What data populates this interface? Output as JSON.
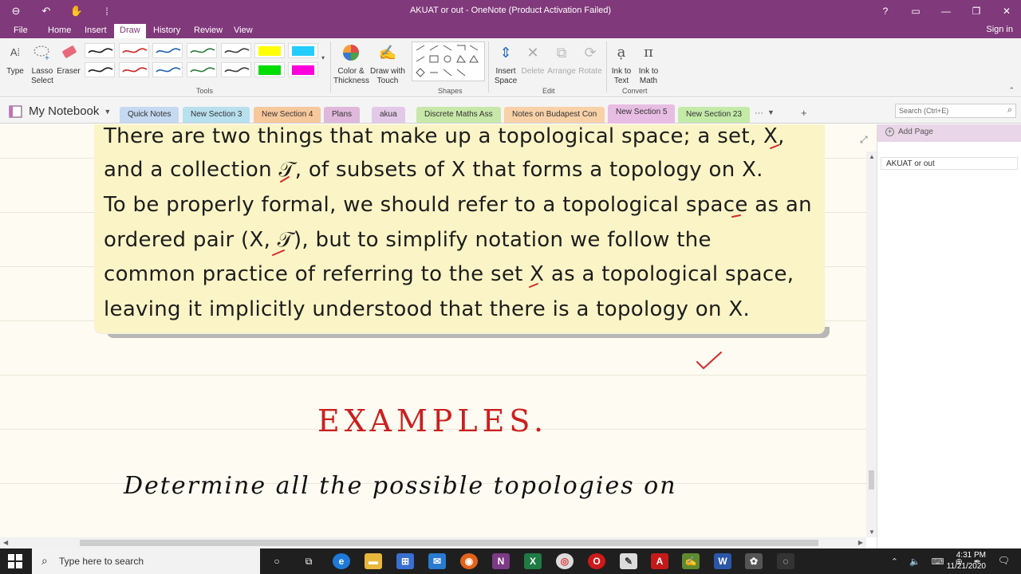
{
  "window": {
    "title": "AKUAT or out - OneNote (Product Activation Failed)",
    "help": "?",
    "ribbon_toggle": "▭",
    "minimize": "—",
    "restore": "❐",
    "close": "✕",
    "back_icon": "⊖",
    "undo_icon": "↶",
    "touch_icon": "✋",
    "customize_icon": "⁞"
  },
  "ribbon_tabs": [
    "File",
    "Home",
    "Insert",
    "Draw",
    "History",
    "Review",
    "View"
  ],
  "signin": "Sign in",
  "ribbon": {
    "type_label": "Type",
    "lasso_label_1": "Lasso",
    "lasso_label_2": "Select",
    "eraser_label": "Eraser",
    "tools_group": "Tools",
    "color_label_1": "Color &",
    "color_label_2": "Thickness",
    "drawtouch_label_1": "Draw with",
    "drawtouch_label_2": "Touch",
    "shapes_group": "Shapes",
    "insert_space_1": "Insert",
    "insert_space_2": "Space",
    "delete_label": "Delete",
    "arrange_label": "Arrange",
    "rotate_label": "Rotate",
    "edit_group": "Edit",
    "ink_text_1": "Ink to",
    "ink_text_2": "Text",
    "ink_math_1": "Ink to",
    "ink_math_2": "Math",
    "convert_group": "Convert",
    "pen_colors": [
      "#1a1a1a",
      "#cc2222",
      "#1f5fa8",
      "#2a7a3a",
      "#3a3a3a",
      "#1a1a1a",
      "#cc2222",
      "#1f5fa8",
      "#2a7a3a",
      "#3a3a3a"
    ],
    "highlighters": [
      "#ffff00",
      "#22ccff",
      "#00dd00",
      "#ff00dd"
    ]
  },
  "notebook": {
    "name": "My Notebook",
    "sections": [
      {
        "label": "Quick Notes",
        "color": "#c5d9f1"
      },
      {
        "label": "New Section 3",
        "color": "#b8e0ee"
      },
      {
        "label": "New Section 4",
        "color": "#f7c89c"
      },
      {
        "label": "Plans",
        "color": "#e0b8dc"
      },
      {
        "label": "akua",
        "color": "#e3c9e8"
      },
      {
        "label": "Discrete Maths Ass",
        "color": "#c7e8a8"
      },
      {
        "label": "Notes on Budapest Con",
        "color": "#f8d1a8"
      },
      {
        "label": "New Section 5",
        "color": "#e8bde3"
      },
      {
        "label": "New Section 23",
        "color": "#c4eaa8"
      }
    ],
    "more": "···",
    "add": "+",
    "search_placeholder": "Search (Ctrl+E)"
  },
  "note": {
    "lines": [
      "There are two things that make up a topological space; a set, X,",
      "and a collection 𝒯, of subsets of X that forms a topology on X.",
      "To be properly formal, we should refer to a topological space as an",
      "ordered pair (X, 𝒯), but to simplify notation we follow the",
      "common practice of referring to the set X as a topological space,",
      "leaving it implicitly understood that there is a topology on X."
    ],
    "examples": "EXAMPLES.",
    "handwriting": "Determine  all  the  possible  topologies  on"
  },
  "pages": {
    "add_page": "Add Page",
    "items": [
      "AKUAT or out"
    ]
  },
  "taskbar": {
    "search_placeholder": "Type here to search",
    "time": "4:31 PM",
    "date": "11/21/2020"
  }
}
